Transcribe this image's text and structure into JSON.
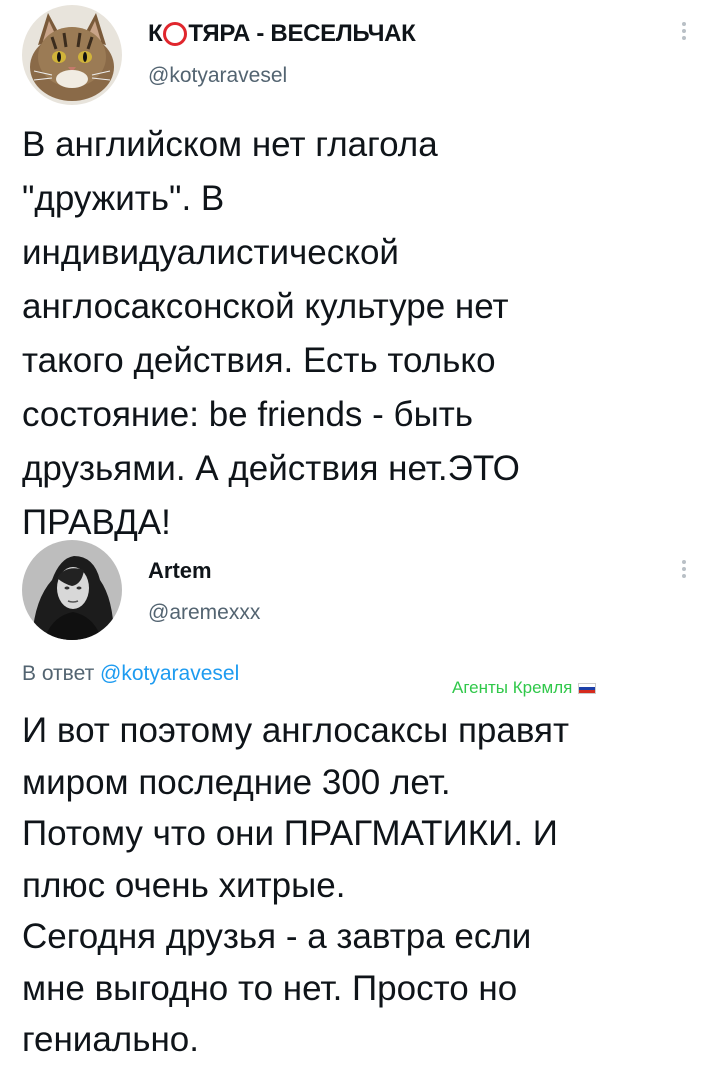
{
  "tweet1": {
    "author_prefix": "К",
    "author_suffix": "ТЯРА - ВЕСЕЛЬЧАК",
    "handle": "@kotyaravesel",
    "text": "В английском нет глагола\n\"дружить\". В\nиндивидуалистической\nанглосаксонской культуре нет\nтакого действия. Есть только\nсостояние: be friends - быть\nдрузьями. А действия нет.ЭТО\nПРАВДА!",
    "avatar_icon": "cat-avatar",
    "more_icon": "more-vertical-icon"
  },
  "tweet2": {
    "author": "Artem",
    "handle": "@aremexxx",
    "reply_prefix": "В ответ",
    "reply_handle": "@kotyaravesel",
    "badge": "Агенты Кремля",
    "badge_flag": "russia-flag-icon",
    "text": "И вот поэтому англосаксы правят\nмиром последние 300 лет.\nПотому что они ПРАГМАТИКИ. И\nплюс очень хитрые.\nСегодня друзья - а завтра если\nмне выгодно то нет. Просто но\nгениально.",
    "avatar_icon": "person-avatar",
    "more_icon": "more-vertical-icon"
  },
  "colors": {
    "handle": "#536471",
    "link": "#1d9bf0",
    "badge": "#30c84a",
    "brand_ring": "#e0262d"
  }
}
